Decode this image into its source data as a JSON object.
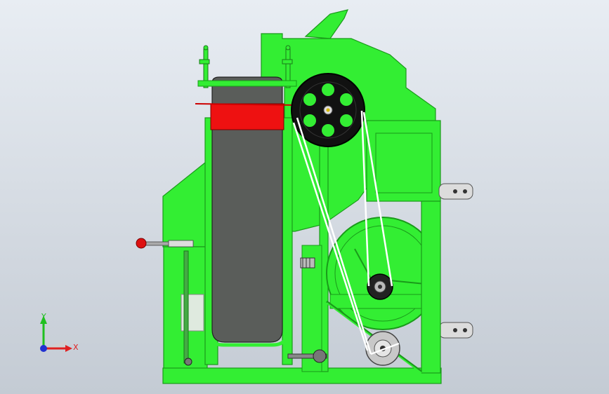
{
  "triad": {
    "x_label": "X",
    "y_label": "Y",
    "x_color": "#e02020",
    "y_color": "#20c020",
    "z_color": "#2030d0"
  },
  "colors": {
    "frame": "#33ee33",
    "frame_dark": "#1a9a1a",
    "belt": "#5a5d5a",
    "accent_red": "#ee1111",
    "wheel": "#111111",
    "viewport_top": "#e8edf3",
    "viewport_bottom": "#c4cbd4"
  }
}
